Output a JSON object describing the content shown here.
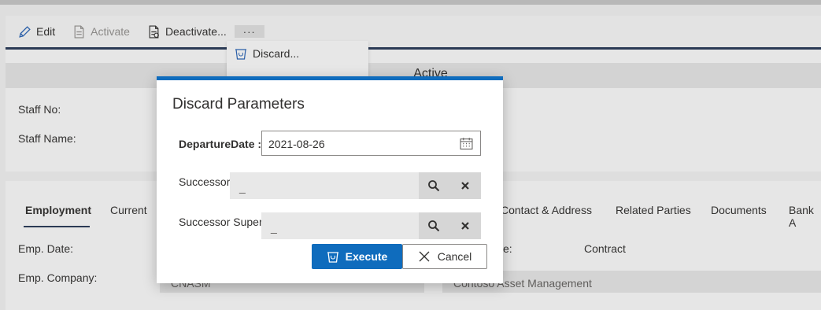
{
  "toolbar": {
    "edit_label": "Edit",
    "activate_label": "Activate",
    "deactivate_label": "Deactivate...",
    "more_label": "···"
  },
  "dropdown": {
    "discard_label": "Discard..."
  },
  "header": {
    "status": "Active",
    "staff_no_label": "Staff No:",
    "staff_name_label": "Staff Name:"
  },
  "tabs": [
    {
      "label": "Employment"
    },
    {
      "label": "Current"
    },
    {
      "label": "Contact & Address"
    },
    {
      "label": "Related Parties"
    },
    {
      "label": "Documents"
    },
    {
      "label": "Bank A"
    }
  ],
  "employment": {
    "emp_date_label": "Emp. Date:",
    "emp_company_label": "Emp. Company:",
    "emp_company_value": "CNASM",
    "type_label_fragment": "e:",
    "type_value": "Contract",
    "company_name_value": "Contoso Asset Management"
  },
  "dialog": {
    "title": "Discard Parameters",
    "departure_label": "DepartureDate :",
    "departure_value": "2021-08-26",
    "successor_label": "Successor",
    "successor_value": "_",
    "successor_super_label": "Successor Super",
    "successor_super_value": "_",
    "execute_label": "Execute",
    "cancel_label": "Cancel"
  },
  "colors": {
    "accent": "#0f6cbd",
    "toolbar_line": "#2b3a55"
  }
}
